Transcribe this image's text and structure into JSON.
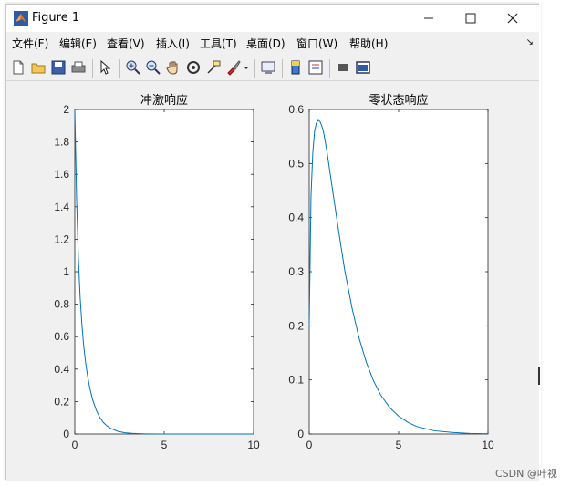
{
  "window": {
    "title": "Figure 1",
    "minimize_glyph": "—",
    "maximize_glyph": "☐",
    "close_glyph": "✕"
  },
  "menu": {
    "items": [
      {
        "label": "文件(F)"
      },
      {
        "label": "编辑(E)"
      },
      {
        "label": "查看(V)"
      },
      {
        "label": "插入(I)"
      },
      {
        "label": "工具(T)"
      },
      {
        "label": "桌面(D)"
      },
      {
        "label": "窗口(W)"
      },
      {
        "label": "帮助(H)"
      }
    ],
    "overflow_glyph": "↘"
  },
  "toolbar": {
    "icons": [
      "new-figure-icon",
      "open-file-icon",
      "save-icon",
      "print-icon",
      "edit-plot-pointer-icon",
      "zoom-in-icon",
      "zoom-out-icon",
      "pan-hand-icon",
      "rotate-3d-icon",
      "data-cursor-icon",
      "brush-icon",
      "brush-dropdown-icon",
      "link-plot-icon",
      "insert-colorbar-icon",
      "insert-legend-icon",
      "hide-plot-tools-icon",
      "show-plot-tools-icon"
    ]
  },
  "chart_data": [
    {
      "type": "line",
      "title": "冲激响应",
      "xlim": [
        0,
        10
      ],
      "ylim": [
        0,
        2
      ],
      "xticks": [
        "0",
        "5",
        "10"
      ],
      "yticks": [
        "0",
        "0.2",
        "0.4",
        "0.6",
        "0.8",
        "1",
        "1.2",
        "1.4",
        "1.6",
        "1.8",
        "2"
      ],
      "series": [
        {
          "color": "#0072bd",
          "x": [
            0,
            0.1,
            0.2,
            0.3,
            0.4,
            0.5,
            0.6,
            0.7,
            0.8,
            0.9,
            1.0,
            1.2,
            1.4,
            1.6,
            1.8,
            2.0,
            2.4,
            2.8,
            3.2,
            3.6,
            4.0,
            5.0,
            6.0,
            7.0,
            8.0,
            9.0,
            10.0
          ],
          "y": [
            2.0,
            1.45,
            1.08,
            0.84,
            0.67,
            0.54,
            0.445,
            0.368,
            0.305,
            0.254,
            0.211,
            0.147,
            0.102,
            0.071,
            0.05,
            0.035,
            0.017,
            0.008,
            0.004,
            0.002,
            0.001,
            0.0002,
            0,
            0,
            0,
            0,
            0
          ]
        }
      ]
    },
    {
      "type": "line",
      "title": "零状态响应",
      "xlim": [
        0,
        10
      ],
      "ylim": [
        0,
        0.6
      ],
      "xticks": [
        "0",
        "5",
        "10"
      ],
      "yticks": [
        "0",
        "0.1",
        "0.2",
        "0.3",
        "0.4",
        "0.5",
        "0.6"
      ],
      "series": [
        {
          "color": "#0072bd",
          "x": [
            0,
            0.1,
            0.2,
            0.3,
            0.4,
            0.5,
            0.6,
            0.7,
            0.8,
            0.9,
            1.0,
            1.2,
            1.4,
            1.6,
            1.8,
            2.0,
            2.4,
            2.8,
            3.2,
            3.6,
            4.0,
            4.5,
            5.0,
            5.5,
            6.0,
            7.0,
            8.0,
            9.0,
            10.0
          ],
          "y": [
            0.2,
            0.44,
            0.52,
            0.56,
            0.575,
            0.58,
            0.578,
            0.57,
            0.558,
            0.54,
            0.52,
            0.475,
            0.43,
            0.385,
            0.342,
            0.3,
            0.232,
            0.176,
            0.132,
            0.098,
            0.072,
            0.049,
            0.033,
            0.022,
            0.014,
            0.006,
            0.003,
            0.001,
            0.0005
          ]
        }
      ]
    }
  ],
  "watermark": "CSDN @叶视"
}
